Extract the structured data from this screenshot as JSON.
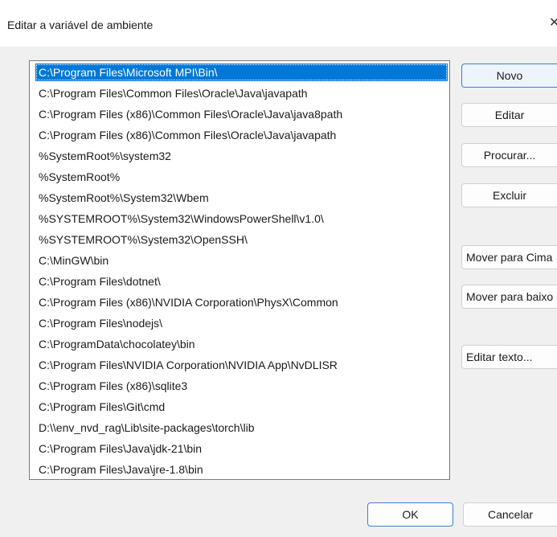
{
  "window": {
    "title": "Editar a variável de ambiente",
    "close_glyph": "✕"
  },
  "paths": [
    "C:\\Program Files\\Microsoft MPI\\Bin\\",
    "C:\\Program Files\\Common Files\\Oracle\\Java\\javapath",
    "C:\\Program Files (x86)\\Common Files\\Oracle\\Java\\java8path",
    "C:\\Program Files (x86)\\Common Files\\Oracle\\Java\\javapath",
    "%SystemRoot%\\system32",
    "%SystemRoot%",
    "%SystemRoot%\\System32\\Wbem",
    "%SYSTEMROOT%\\System32\\WindowsPowerShell\\v1.0\\",
    "%SYSTEMROOT%\\System32\\OpenSSH\\",
    "C:\\MinGW\\bin",
    "C:\\Program Files\\dotnet\\",
    "C:\\Program Files (x86)\\NVIDIA Corporation\\PhysX\\Common",
    "C:\\Program Files\\nodejs\\",
    "C:\\ProgramData\\chocolatey\\bin",
    "C:\\Program Files\\NVIDIA Corporation\\NVIDIA App\\NvDLISR",
    "C:\\Program Files (x86)\\sqlite3",
    "C:\\Program Files\\Git\\cmd",
    "D:\\\\env_nvd_rag\\Lib\\site-packages\\torch\\lib",
    "C:\\Program Files\\Java\\jdk-21\\bin",
    "C:\\Program Files\\Java\\jre-1.8\\bin"
  ],
  "selected_index": 0,
  "buttons": {
    "novo": "Novo",
    "editar": "Editar",
    "procurar": "Procurar...",
    "excluir": "Excluir",
    "mover_cima": "Mover para Cima",
    "mover_baixo": "Mover para baixo",
    "editar_texto": "Editar texto...",
    "ok": "OK",
    "cancelar": "Cancelar"
  },
  "colors": {
    "selection": "#0078d7",
    "accent_border": "#3c7fd0",
    "dialog_bg": "#f0f0f0"
  }
}
